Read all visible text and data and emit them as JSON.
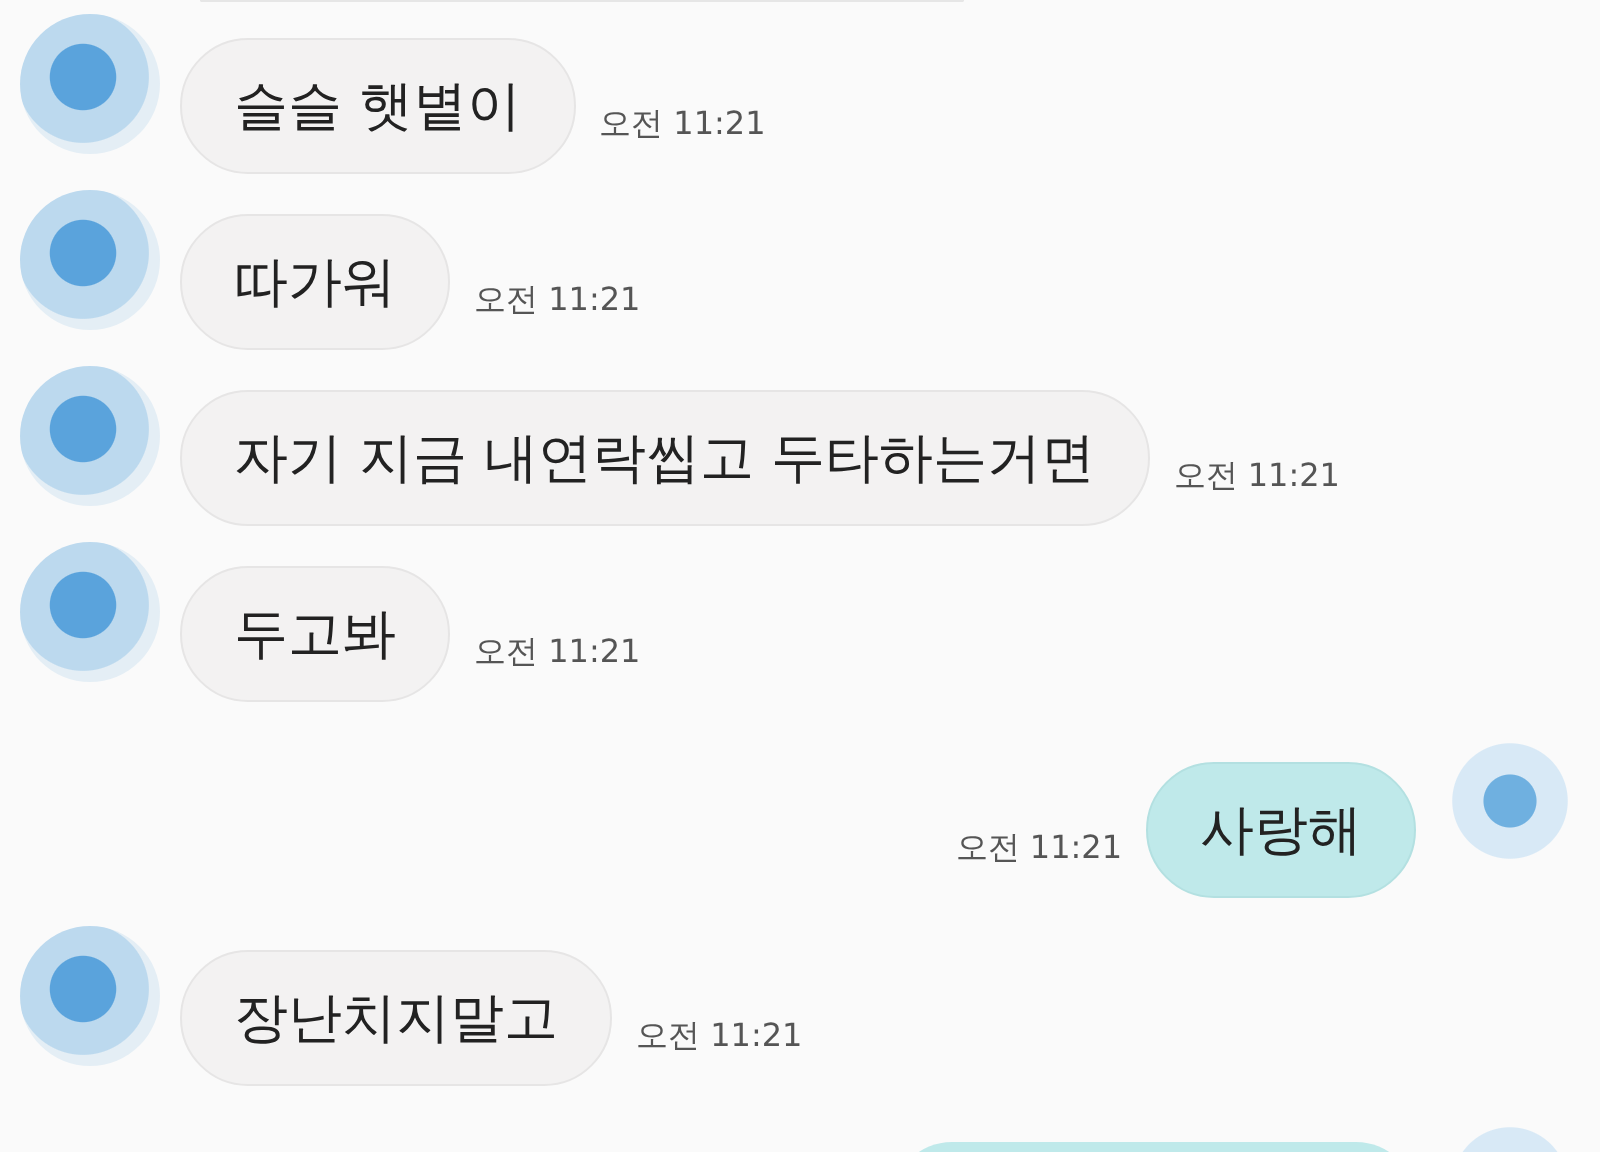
{
  "messages": [
    {
      "kind": "stub",
      "outgoing": false
    },
    {
      "kind": "message",
      "outgoing": false,
      "text": "슬슬 햇볕이",
      "time": "오전 11:21"
    },
    {
      "kind": "message",
      "outgoing": false,
      "text": "따가워",
      "time": "오전 11:21"
    },
    {
      "kind": "message",
      "outgoing": false,
      "text": "자기 지금 내연락씹고 두타하는거면",
      "time": "오전 11:21"
    },
    {
      "kind": "message",
      "outgoing": false,
      "text": "두고봐",
      "time": "오전 11:21"
    },
    {
      "kind": "message",
      "outgoing": true,
      "text": "사랑해",
      "time": "오전 11:21"
    },
    {
      "kind": "message",
      "outgoing": false,
      "text": "장난치지말고",
      "time": "오전 11:21"
    },
    {
      "kind": "stub",
      "outgoing": true
    }
  ]
}
